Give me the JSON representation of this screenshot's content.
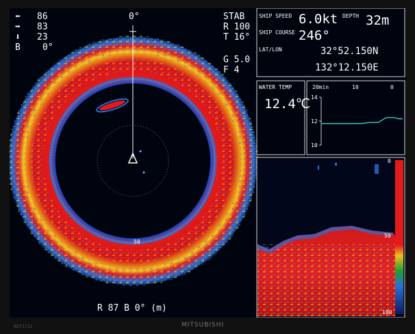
{
  "sonar": {
    "left_readouts": [
      {
        "icon": "arrow-left-icon",
        "value": "86"
      },
      {
        "icon": "arrow-right-icon",
        "value": "83"
      },
      {
        "icon": "arrow-down-icon",
        "value": "23"
      },
      {
        "icon": "",
        "label": "B",
        "value": "0°"
      }
    ],
    "right_readouts": [
      "STAB",
      "R 100",
      "T 16°",
      "G 5.0",
      "F 4"
    ],
    "heading_marker": "0°",
    "range_ring_label": "50",
    "bottom_status": "R  87 B  0°  (m)"
  },
  "nav": {
    "ship_speed_label": "SHIP SPEED",
    "ship_speed_value": "6.0kt",
    "depth_label": "DEPTH",
    "depth_value": "32m",
    "ship_course_label": "SHIP COURSE",
    "ship_course_value": "246°",
    "latlon_label": "LAT/LON",
    "lat_value": "32°52.150N",
    "lon_value": "132°12.150E"
  },
  "water": {
    "label": "WATER TEMP",
    "value": "12.4℃"
  },
  "temp_graph": {
    "top_labels": [
      "20min",
      "10",
      "0"
    ],
    "y_labels": [
      "14",
      "12",
      "10"
    ],
    "chart_data": {
      "type": "line",
      "x": [
        20,
        18,
        16,
        14,
        12,
        10,
        8,
        6,
        4,
        2,
        1,
        0
      ],
      "y": [
        11.8,
        11.8,
        11.8,
        11.8,
        11.8,
        11.8,
        11.9,
        11.9,
        12.3,
        12.3,
        12.2,
        12.2
      ],
      "xlim": [
        20,
        0
      ],
      "ylim": [
        10,
        14
      ],
      "series_color": "#43c7c3"
    }
  },
  "echo": {
    "depth_labels": [
      "0",
      "50",
      "100"
    ]
  },
  "bezel": {
    "brand": "MITSUBISHI",
    "model": "RDT1711"
  },
  "colors": {
    "strong_echo": "#e31a1a",
    "mid_echo": "#f0c020",
    "weak_echo": "#2a6fd6",
    "text": "#ffffff",
    "temp_line": "#43c7c3"
  }
}
